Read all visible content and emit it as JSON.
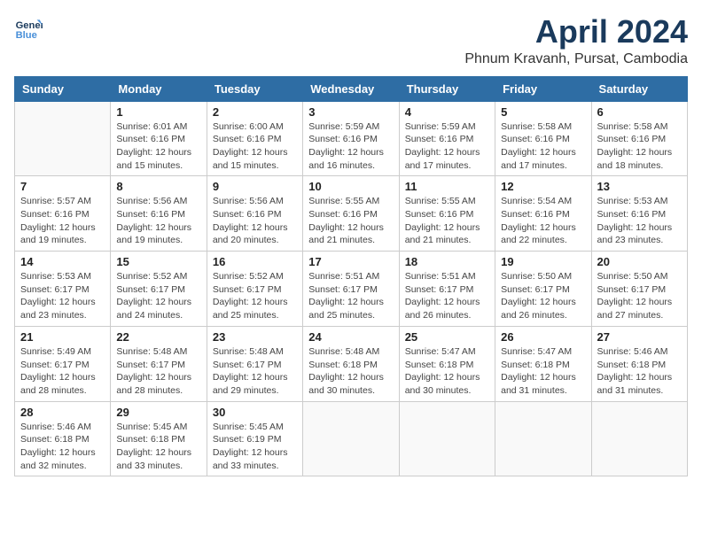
{
  "header": {
    "logo_line1": "General",
    "logo_line2": "Blue",
    "title": "April 2024",
    "subtitle": "Phnum Kravanh, Pursat, Cambodia"
  },
  "weekdays": [
    "Sunday",
    "Monday",
    "Tuesday",
    "Wednesday",
    "Thursday",
    "Friday",
    "Saturday"
  ],
  "weeks": [
    [
      {
        "day": "",
        "empty": true
      },
      {
        "day": "1",
        "sunrise": "Sunrise: 6:01 AM",
        "sunset": "Sunset: 6:16 PM",
        "daylight": "Daylight: 12 hours and 15 minutes."
      },
      {
        "day": "2",
        "sunrise": "Sunrise: 6:00 AM",
        "sunset": "Sunset: 6:16 PM",
        "daylight": "Daylight: 12 hours and 15 minutes."
      },
      {
        "day": "3",
        "sunrise": "Sunrise: 5:59 AM",
        "sunset": "Sunset: 6:16 PM",
        "daylight": "Daylight: 12 hours and 16 minutes."
      },
      {
        "day": "4",
        "sunrise": "Sunrise: 5:59 AM",
        "sunset": "Sunset: 6:16 PM",
        "daylight": "Daylight: 12 hours and 17 minutes."
      },
      {
        "day": "5",
        "sunrise": "Sunrise: 5:58 AM",
        "sunset": "Sunset: 6:16 PM",
        "daylight": "Daylight: 12 hours and 17 minutes."
      },
      {
        "day": "6",
        "sunrise": "Sunrise: 5:58 AM",
        "sunset": "Sunset: 6:16 PM",
        "daylight": "Daylight: 12 hours and 18 minutes."
      }
    ],
    [
      {
        "day": "7",
        "sunrise": "Sunrise: 5:57 AM",
        "sunset": "Sunset: 6:16 PM",
        "daylight": "Daylight: 12 hours and 19 minutes."
      },
      {
        "day": "8",
        "sunrise": "Sunrise: 5:56 AM",
        "sunset": "Sunset: 6:16 PM",
        "daylight": "Daylight: 12 hours and 19 minutes."
      },
      {
        "day": "9",
        "sunrise": "Sunrise: 5:56 AM",
        "sunset": "Sunset: 6:16 PM",
        "daylight": "Daylight: 12 hours and 20 minutes."
      },
      {
        "day": "10",
        "sunrise": "Sunrise: 5:55 AM",
        "sunset": "Sunset: 6:16 PM",
        "daylight": "Daylight: 12 hours and 21 minutes."
      },
      {
        "day": "11",
        "sunrise": "Sunrise: 5:55 AM",
        "sunset": "Sunset: 6:16 PM",
        "daylight": "Daylight: 12 hours and 21 minutes."
      },
      {
        "day": "12",
        "sunrise": "Sunrise: 5:54 AM",
        "sunset": "Sunset: 6:16 PM",
        "daylight": "Daylight: 12 hours and 22 minutes."
      },
      {
        "day": "13",
        "sunrise": "Sunrise: 5:53 AM",
        "sunset": "Sunset: 6:16 PM",
        "daylight": "Daylight: 12 hours and 23 minutes."
      }
    ],
    [
      {
        "day": "14",
        "sunrise": "Sunrise: 5:53 AM",
        "sunset": "Sunset: 6:17 PM",
        "daylight": "Daylight: 12 hours and 23 minutes."
      },
      {
        "day": "15",
        "sunrise": "Sunrise: 5:52 AM",
        "sunset": "Sunset: 6:17 PM",
        "daylight": "Daylight: 12 hours and 24 minutes."
      },
      {
        "day": "16",
        "sunrise": "Sunrise: 5:52 AM",
        "sunset": "Sunset: 6:17 PM",
        "daylight": "Daylight: 12 hours and 25 minutes."
      },
      {
        "day": "17",
        "sunrise": "Sunrise: 5:51 AM",
        "sunset": "Sunset: 6:17 PM",
        "daylight": "Daylight: 12 hours and 25 minutes."
      },
      {
        "day": "18",
        "sunrise": "Sunrise: 5:51 AM",
        "sunset": "Sunset: 6:17 PM",
        "daylight": "Daylight: 12 hours and 26 minutes."
      },
      {
        "day": "19",
        "sunrise": "Sunrise: 5:50 AM",
        "sunset": "Sunset: 6:17 PM",
        "daylight": "Daylight: 12 hours and 26 minutes."
      },
      {
        "day": "20",
        "sunrise": "Sunrise: 5:50 AM",
        "sunset": "Sunset: 6:17 PM",
        "daylight": "Daylight: 12 hours and 27 minutes."
      }
    ],
    [
      {
        "day": "21",
        "sunrise": "Sunrise: 5:49 AM",
        "sunset": "Sunset: 6:17 PM",
        "daylight": "Daylight: 12 hours and 28 minutes."
      },
      {
        "day": "22",
        "sunrise": "Sunrise: 5:48 AM",
        "sunset": "Sunset: 6:17 PM",
        "daylight": "Daylight: 12 hours and 28 minutes."
      },
      {
        "day": "23",
        "sunrise": "Sunrise: 5:48 AM",
        "sunset": "Sunset: 6:17 PM",
        "daylight": "Daylight: 12 hours and 29 minutes."
      },
      {
        "day": "24",
        "sunrise": "Sunrise: 5:48 AM",
        "sunset": "Sunset: 6:18 PM",
        "daylight": "Daylight: 12 hours and 30 minutes."
      },
      {
        "day": "25",
        "sunrise": "Sunrise: 5:47 AM",
        "sunset": "Sunset: 6:18 PM",
        "daylight": "Daylight: 12 hours and 30 minutes."
      },
      {
        "day": "26",
        "sunrise": "Sunrise: 5:47 AM",
        "sunset": "Sunset: 6:18 PM",
        "daylight": "Daylight: 12 hours and 31 minutes."
      },
      {
        "day": "27",
        "sunrise": "Sunrise: 5:46 AM",
        "sunset": "Sunset: 6:18 PM",
        "daylight": "Daylight: 12 hours and 31 minutes."
      }
    ],
    [
      {
        "day": "28",
        "sunrise": "Sunrise: 5:46 AM",
        "sunset": "Sunset: 6:18 PM",
        "daylight": "Daylight: 12 hours and 32 minutes."
      },
      {
        "day": "29",
        "sunrise": "Sunrise: 5:45 AM",
        "sunset": "Sunset: 6:18 PM",
        "daylight": "Daylight: 12 hours and 33 minutes."
      },
      {
        "day": "30",
        "sunrise": "Sunrise: 5:45 AM",
        "sunset": "Sunset: 6:19 PM",
        "daylight": "Daylight: 12 hours and 33 minutes."
      },
      {
        "day": "",
        "empty": true
      },
      {
        "day": "",
        "empty": true
      },
      {
        "day": "",
        "empty": true
      },
      {
        "day": "",
        "empty": true
      }
    ]
  ]
}
